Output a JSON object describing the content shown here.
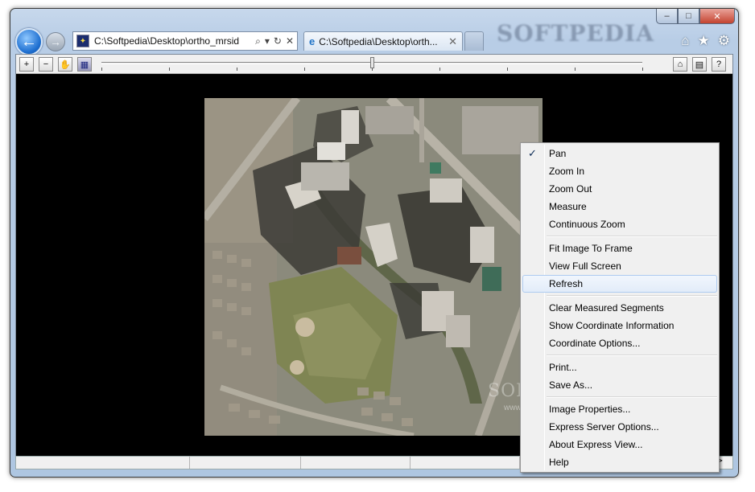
{
  "window": {
    "controls": {
      "minimize": "‒",
      "maximize": "□",
      "close": "✕"
    },
    "brand": "SOFTPEDIA"
  },
  "nav": {
    "back_icon": "←",
    "forward_icon": "→",
    "address": {
      "value": "C:\\Softpedia\\Desktop\\ortho_mrsid",
      "search_icon": "⌕",
      "dropdown_icon": "▾",
      "refresh_icon": "↻",
      "stop_icon": "✕"
    },
    "tab": {
      "label": "C:\\Softpedia\\Desktop\\orth...",
      "close": "✕",
      "icon": "e"
    },
    "right_icons": {
      "home": "⌂",
      "favorites": "★",
      "tools": "⚙"
    }
  },
  "viewer_toolbar": {
    "zoom_in": "+",
    "zoom_out": "−",
    "pan": "✋",
    "measure": "▦",
    "home": "⌂",
    "properties": "▤",
    "help": "?",
    "zoom_level": 0.5
  },
  "context_menu": {
    "groups": [
      [
        {
          "label": "Pan",
          "checked": true
        },
        {
          "label": "Zoom In"
        },
        {
          "label": "Zoom Out"
        },
        {
          "label": "Measure"
        },
        {
          "label": "Continuous Zoom"
        }
      ],
      [
        {
          "label": "Fit Image To Frame"
        },
        {
          "label": "View Full Screen"
        },
        {
          "label": "Refresh",
          "hover": true
        }
      ],
      [
        {
          "label": "Clear Measured Segments"
        },
        {
          "label": "Show Coordinate Information"
        },
        {
          "label": "Coordinate Options..."
        }
      ],
      [
        {
          "label": "Print..."
        },
        {
          "label": "Save As..."
        }
      ],
      [
        {
          "label": "Image Properties..."
        },
        {
          "label": "Express Server Options..."
        },
        {
          "label": "About Express View..."
        },
        {
          "label": "Help"
        }
      ]
    ],
    "check_icon": "✓"
  },
  "watermark": {
    "text": "SOFTPEDIA",
    "url": "www.softpedia.com"
  },
  "statusbar": {
    "right_arrow": "⊳"
  }
}
